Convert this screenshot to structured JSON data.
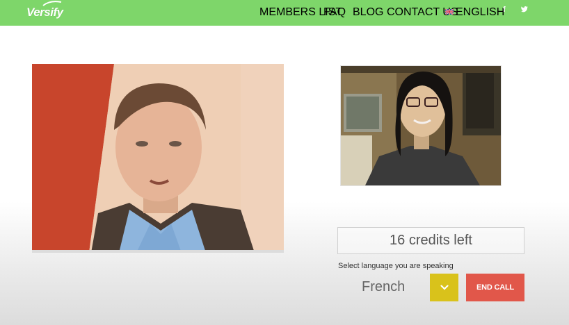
{
  "brand": {
    "logo_text": "Versify"
  },
  "nav": {
    "items": [
      {
        "label": "MEMBERS LIST"
      },
      {
        "label": "FAQ"
      },
      {
        "label": "BLOG"
      },
      {
        "label": "CONTACT US"
      }
    ],
    "language": {
      "label": "ENGLISH",
      "icon": "uk-flag-icon"
    },
    "social": {
      "facebook": "f",
      "twitter": "twitter-icon"
    }
  },
  "call": {
    "credits_text": "16 credits left",
    "language_prompt": "Select language you are speaking",
    "selected_language": "French",
    "end_call_label": "END CALL"
  },
  "colors": {
    "topbar": "#7ed66a",
    "dropdown": "#d9c21b",
    "end_call": "#e1574a"
  }
}
